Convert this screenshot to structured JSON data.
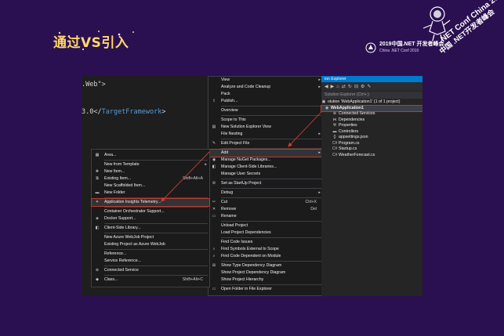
{
  "slide": {
    "title": "通过VS引入",
    "conference_badge": "2019中国.NET 开发者峰会",
    "conference_badge_sub": "China .NET Conf 2019",
    "corner_line1": ".NET Conf China 2019",
    "corner_line2": "中国 .NET开发者峰会"
  },
  "editor": {
    "line1_text": ".Web\">",
    "line2_prefix": "3.0</",
    "line2_tag": "TargetFramework",
    "line2_suffix": ">"
  },
  "add_menu": {
    "items": [
      {
        "label": "Area...",
        "icon": "area-icon",
        "shortcut": ""
      },
      {
        "label": "New from Template",
        "icon": "",
        "shortcut": "",
        "arrow": true
      },
      {
        "label": "New Item...",
        "icon": "new-item-icon",
        "shortcut": ""
      },
      {
        "label": "Existing Item...",
        "icon": "existing-item-icon",
        "shortcut": "Shift+Alt+A"
      },
      {
        "label": "New Scaffolded Item...",
        "icon": "",
        "shortcut": ""
      },
      {
        "label": "New Folder",
        "icon": "folder-icon",
        "shortcut": ""
      },
      {
        "label": "Application Insights Telemetry...",
        "icon": "telemetry-icon",
        "shortcut": "",
        "highlight": true
      },
      {
        "label": "Container Orchestrator Support...",
        "icon": "",
        "shortcut": ""
      },
      {
        "label": "Docker Support...",
        "icon": "docker-icon",
        "shortcut": ""
      },
      {
        "label": "Client-Side Library...",
        "icon": "client-library-icon",
        "shortcut": ""
      },
      {
        "label": "New Azure WebJob Project",
        "icon": "",
        "shortcut": ""
      },
      {
        "label": "Existing Project as Azure WebJob",
        "icon": "",
        "shortcut": ""
      },
      {
        "label": "Reference...",
        "icon": "",
        "shortcut": ""
      },
      {
        "label": "Service Reference...",
        "icon": "",
        "shortcut": ""
      },
      {
        "label": "Connected Service",
        "icon": "connected-service-icon",
        "shortcut": ""
      },
      {
        "label": "Class...",
        "icon": "class-icon",
        "shortcut": "Shift+Alt+C"
      }
    ]
  },
  "context_menu": {
    "items": [
      {
        "label": "View",
        "icon": "",
        "shortcut": "",
        "arrow": true
      },
      {
        "label": "Analyze and Code Cleanup",
        "icon": "",
        "shortcut": "",
        "arrow": true
      },
      {
        "label": "Pack",
        "icon": "",
        "shortcut": ""
      },
      {
        "label": "Publish...",
        "icon": "publish-icon",
        "shortcut": ""
      },
      {
        "label": "Overview",
        "icon": "",
        "shortcut": ""
      },
      {
        "label": "Scope to This",
        "icon": "",
        "shortcut": ""
      },
      {
        "label": "New Solution Explorer View",
        "icon": "new-view-icon",
        "shortcut": ""
      },
      {
        "label": "File Nesting",
        "icon": "",
        "shortcut": "",
        "arrow": true
      },
      {
        "label": "Edit Project File",
        "icon": "edit-icon",
        "shortcut": ""
      },
      {
        "label": "Add",
        "icon": "",
        "shortcut": "",
        "arrow": true,
        "highlight": true
      },
      {
        "label": "Manage NuGet Packages...",
        "icon": "nuget-icon",
        "shortcut": ""
      },
      {
        "label": "Manage Client-Side Libraries...",
        "icon": "client-library-icon",
        "shortcut": ""
      },
      {
        "label": "Manage User Secrets",
        "icon": "",
        "shortcut": ""
      },
      {
        "label": "Set as StartUp Project",
        "icon": "gear-icon",
        "shortcut": ""
      },
      {
        "label": "Debug",
        "icon": "",
        "shortcut": "",
        "arrow": true
      },
      {
        "label": "Cut",
        "icon": "cut-icon",
        "shortcut": "Ctrl+X"
      },
      {
        "label": "Remove",
        "icon": "remove-icon",
        "shortcut": "Del"
      },
      {
        "label": "Rename",
        "icon": "rename-icon",
        "shortcut": ""
      },
      {
        "label": "Unload Project",
        "icon": "",
        "shortcut": ""
      },
      {
        "label": "Load Project Dependencies",
        "icon": "",
        "shortcut": ""
      },
      {
        "label": "Find Code Issues",
        "icon": "",
        "shortcut": ""
      },
      {
        "label": "Find Symbols External to Scope",
        "icon": "find-icon",
        "shortcut": ""
      },
      {
        "label": "Find Code Dependent on Module",
        "icon": "find-icon",
        "shortcut": ""
      },
      {
        "label": "Show Type Dependency Diagram",
        "icon": "diagram-icon",
        "shortcut": ""
      },
      {
        "label": "Show Project Dependency Diagram",
        "icon": "",
        "shortcut": ""
      },
      {
        "label": "Show Project Hierarchy",
        "icon": "",
        "shortcut": ""
      },
      {
        "label": "Open Folder in File Explorer",
        "icon": "open-folder-icon",
        "shortcut": ""
      }
    ]
  },
  "solution_explorer": {
    "title": "ion Explorer",
    "search_placeholder": "Solution Explorer (Ctrl+;)",
    "solution_label": "olution 'WebApplication1' (1 of 1 project)",
    "items": [
      {
        "label": "WebApplication1",
        "icon": "project-icon",
        "selected": true
      },
      {
        "label": "Connected Services",
        "icon": "connected-service-icon"
      },
      {
        "label": "Dependencies",
        "icon": "dependencies-icon"
      },
      {
        "label": "Properties",
        "icon": "properties-icon"
      },
      {
        "label": "Controllers",
        "icon": "folder-icon"
      },
      {
        "label": "appsettings.json",
        "icon": "json-file-icon"
      },
      {
        "label": "Program.cs",
        "icon": "cs-file-icon"
      },
      {
        "label": "Startup.cs",
        "icon": "cs-file-icon"
      },
      {
        "label": "WeatherForecast.cs",
        "icon": "cs-file-icon"
      }
    ]
  },
  "colors": {
    "background": "#2b1051",
    "title": "#ffd86b",
    "highlight_outline": "#c0392b",
    "vs_blue": "#007acc"
  }
}
